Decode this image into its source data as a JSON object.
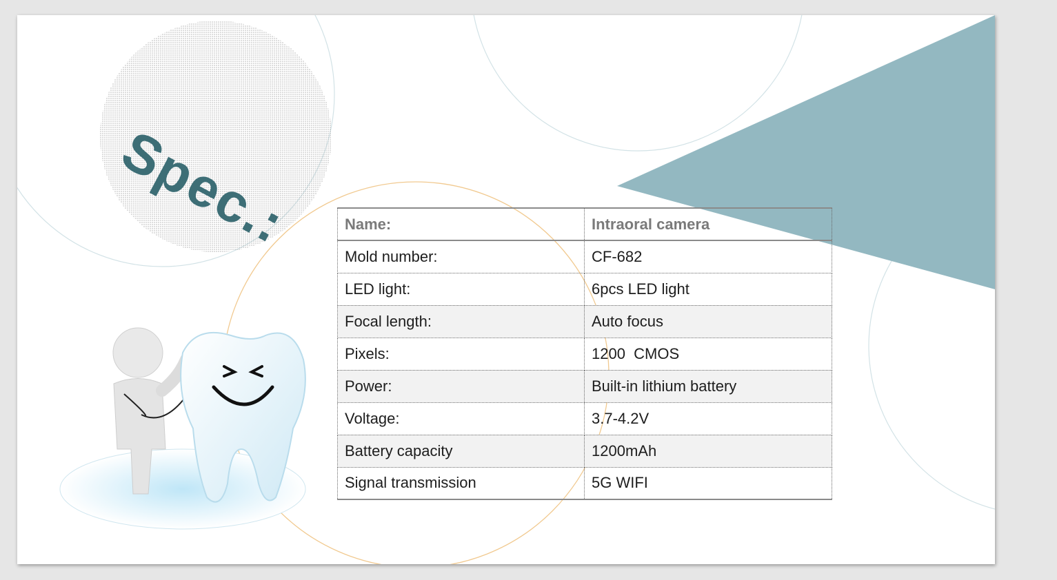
{
  "slide": {
    "title": "Spec.:",
    "accent_color": "#93b8c1",
    "title_color": "#3d6e76"
  },
  "spec_table": {
    "header": [
      "Name:",
      "Intraoral camera"
    ],
    "rows": [
      [
        "Mold number:",
        "CF-682"
      ],
      [
        "LED light:",
        "6pcs LED light"
      ],
      [
        "Focal length:",
        "Auto focus"
      ],
      [
        "Pixels:",
        "1200  CMOS"
      ],
      [
        "Power:",
        "Built-in lithium battery"
      ],
      [
        "Voltage:",
        "3.7-4.2V"
      ],
      [
        "Battery capacity",
        "1200mAh"
      ],
      [
        "Signal transmission",
        "5G WIFI"
      ]
    ]
  },
  "illustration": {
    "icon": "tooth-doctor-illustration"
  }
}
